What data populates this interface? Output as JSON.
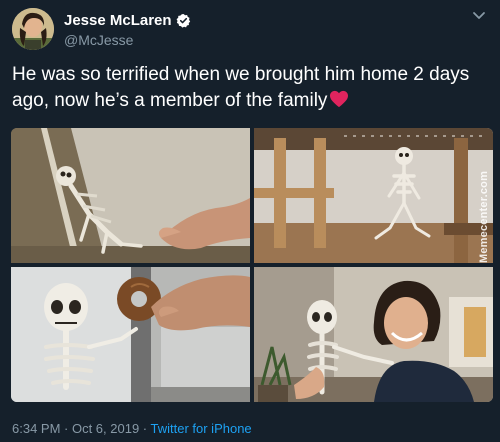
{
  "author": {
    "display_name": "Jesse McLaren",
    "handle": "@McJesse",
    "verified": true
  },
  "tweet": {
    "text": "He was so terrified when we brought him home 2 days ago, now he’s a member of the family",
    "emoji": "red-heart",
    "timestamp": "6:34 PM · Oct 6, 2019 · ",
    "source": "Twitter for iPhone"
  },
  "media": {
    "photo_count": 4,
    "watermark": "Memecenter.com"
  },
  "colors": {
    "background": "#15202b",
    "text": "#ffffff",
    "secondary_text": "#8899a6",
    "link": "#1da1f2",
    "verified_badge": "#ffffff",
    "heart": "#e0245e"
  },
  "icons": {
    "menu": "chevron-down-icon",
    "verified": "verified-badge-icon"
  }
}
